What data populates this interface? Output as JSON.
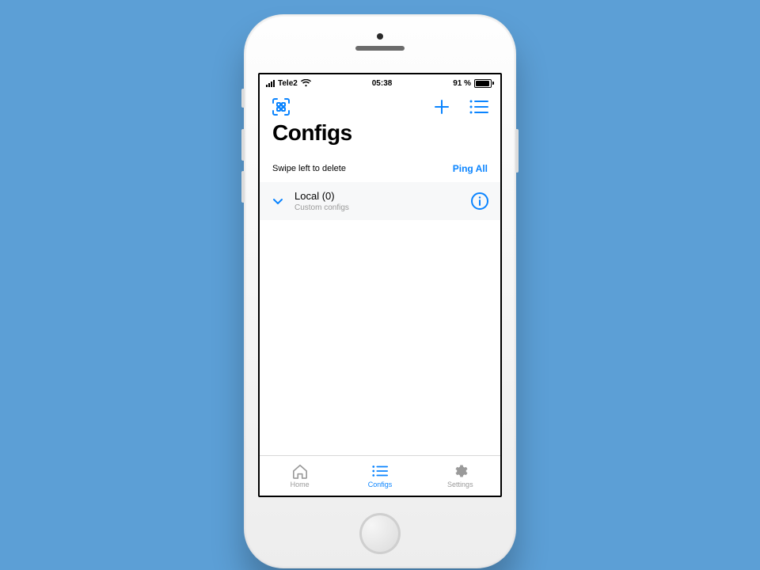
{
  "status": {
    "carrier": "Tele2",
    "time": "05:38",
    "battery_pct": "91 %"
  },
  "toolbar": {},
  "title": "Configs",
  "hint": {
    "text": "Swipe left to delete",
    "action": "Ping All"
  },
  "cells": [
    {
      "title": "Local (0)",
      "subtitle": "Custom configs"
    }
  ],
  "tabs": {
    "home": "Home",
    "configs": "Configs",
    "settings": "Settings"
  }
}
